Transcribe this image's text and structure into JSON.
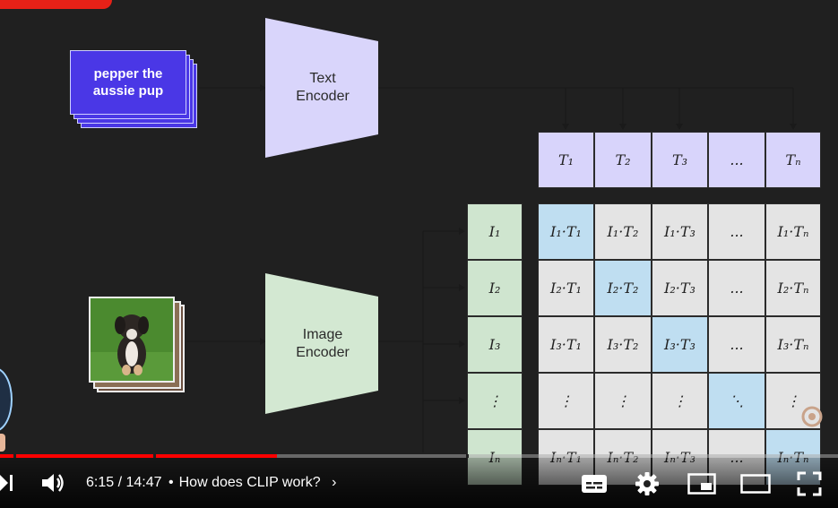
{
  "diagram": {
    "text_input": "pepper the\naussie pup",
    "text_encoder_label": "Text\nEncoder",
    "image_encoder_label": "Image\nEncoder",
    "text_headers": [
      "T₁",
      "T₂",
      "T₃",
      "...",
      "Tₙ"
    ],
    "image_rows": [
      "I₁",
      "I₂",
      "I₃",
      "⋮",
      "Iₙ"
    ],
    "matrix": [
      [
        "I₁·T₁",
        "I₁·T₂",
        "I₁·T₃",
        "...",
        "I₁·Tₙ"
      ],
      [
        "I₂·T₁",
        "I₂·T₂",
        "I₂·T₃",
        "...",
        "I₂·Tₙ"
      ],
      [
        "I₃·T₁",
        "I₃·T₂",
        "I₃·T₃",
        "...",
        "I₃·Tₙ"
      ],
      [
        "⋮",
        "⋮",
        "⋮",
        "⋱",
        "⋮"
      ],
      [
        "Iₙ·T₁",
        "Iₙ·T₂",
        "Iₙ·T₃",
        "...",
        "Iₙ·Tₙ"
      ]
    ],
    "colors": {
      "text_card": "#4a37e6",
      "text_encoder": "#d9d5fb",
      "image_encoder": "#d3e8d2",
      "diagonal": "#bfdef1"
    }
  },
  "player": {
    "current_time": "6:15",
    "duration": "14:47",
    "time_display": "6:15 / 14:47",
    "chapter_title": "How does CLIP work?",
    "progress": 0.33,
    "buttons": {
      "next": "next-icon",
      "volume": "volume-icon",
      "subtitles": "subtitles-icon",
      "settings": "gear-icon",
      "miniplayer": "miniplayer-icon",
      "theater": "theater-icon",
      "fullscreen": "fullscreen-icon"
    }
  }
}
